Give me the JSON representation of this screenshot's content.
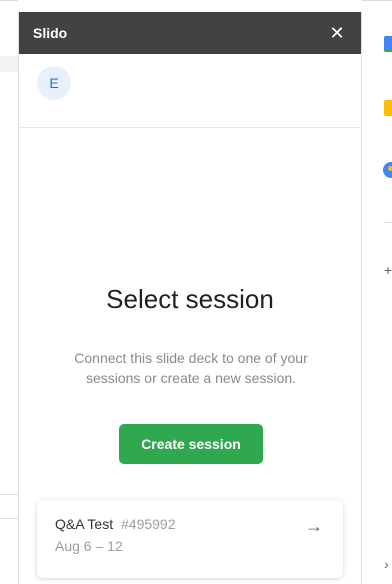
{
  "panel": {
    "title": "Slido",
    "close_glyph": "✕"
  },
  "user": {
    "avatar_initial": "E"
  },
  "main": {
    "heading": "Select session",
    "description": "Connect this slide deck to one of your sessions or create a new session.",
    "create_button_label": "Create session"
  },
  "session": {
    "name": "Q&A Test",
    "code": "#495992",
    "dates": "Aug 6 – 12",
    "arrow_glyph": "→"
  },
  "side_panel": {
    "plus_glyph": "+",
    "expand_glyph": "›"
  },
  "colors": {
    "header_bg": "#424242",
    "accent_green": "#2fa84f",
    "avatar_bg": "#e8f1fb",
    "avatar_text": "#1a73e8"
  },
  "icons": [
    "close-icon",
    "arrow-right-icon",
    "calendar-icon",
    "keep-icon",
    "tasks-icon",
    "plus-icon",
    "expand-icon"
  ]
}
